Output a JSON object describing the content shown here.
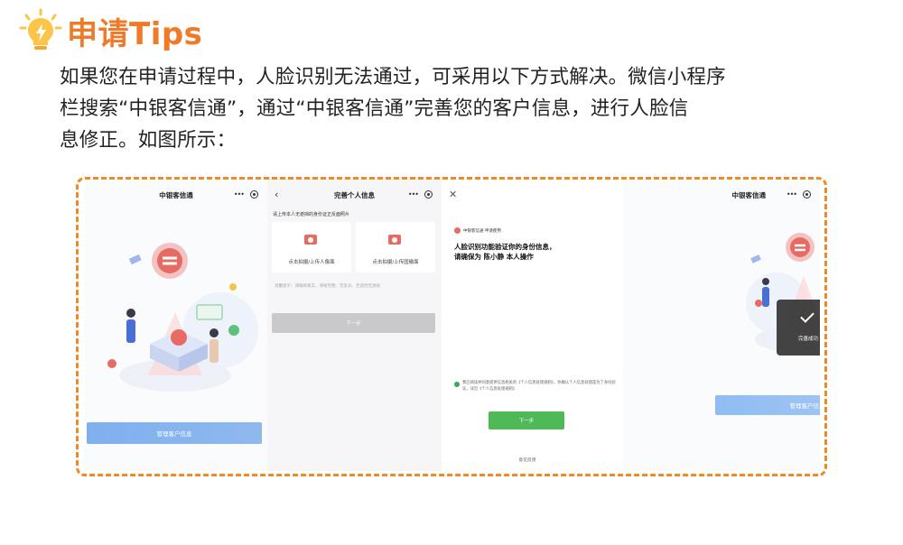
{
  "header": {
    "icon": "lightbulb-icon",
    "title": "申请Tips"
  },
  "description": {
    "line1": "如果您在申请过程中，人脸识别无法通过，可采用以下方式解决。微信小程序",
    "line2": "栏搜索“中银客信通”，通过“中银客信通”完善您的客户信息，进行人脸信",
    "line3": "息修正。如图所示："
  },
  "screen1": {
    "title": "中银客信通",
    "menu_icon": "more-dots-icon",
    "target_icon": "target-icon",
    "button": "管理客户信息"
  },
  "screen2": {
    "title": "完善个人信息",
    "back_icon": "back-arrow-icon",
    "hint": "请上传本人无遮挡的身份证正反面照片",
    "upload_front": "点击拍摄/上传人像面",
    "upload_back": "点击拍摄/上传国徽面",
    "note": "温馨提示：请确保真实、清晰完整、无反光、无遮挡无透视",
    "next": "下一步"
  },
  "screen3": {
    "close_icon": "close-icon",
    "brand": "中银客信通 申请使用",
    "heading_line1": "人脸识别功能验证你的身份信息，",
    "heading_line2": "请确保为 陈小静 本人操作",
    "consent": "我已阅读并同意提供信息相关的《个人信息处理规则》，你确认个人信息处理是为了身份验证，详见《个人信息处理规则》",
    "next": "下一步",
    "feedback": "意见反馈"
  },
  "screen4": {
    "title": "中银客信通",
    "toast": "完善成功",
    "button": "管理客户信息"
  },
  "colors": {
    "title_orange": "#f07a28",
    "frame_orange": "#f08a24",
    "bulb_yellow": "#fbc54a",
    "primary_blue": "#7fb0ee",
    "success_green": "#4fb857",
    "brand_red": "#e86b63"
  }
}
